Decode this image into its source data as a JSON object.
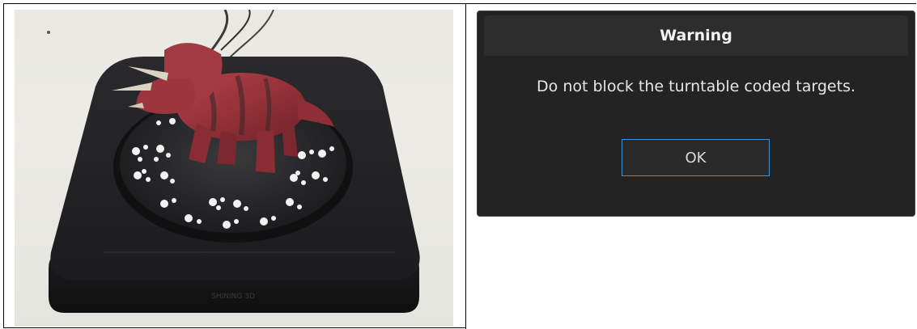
{
  "photo": {
    "subject": "dinosaur-figure-on-turntable",
    "turntable_brand_text": "SHINING 3D"
  },
  "dialog": {
    "title": "Warning",
    "message": "Do not block the turntable coded targets.",
    "ok_label": "OK"
  },
  "colors": {
    "dialog_bg": "#232323",
    "title_bar_bg": "#2d2d2d",
    "button_border": "#3d8fd6"
  }
}
